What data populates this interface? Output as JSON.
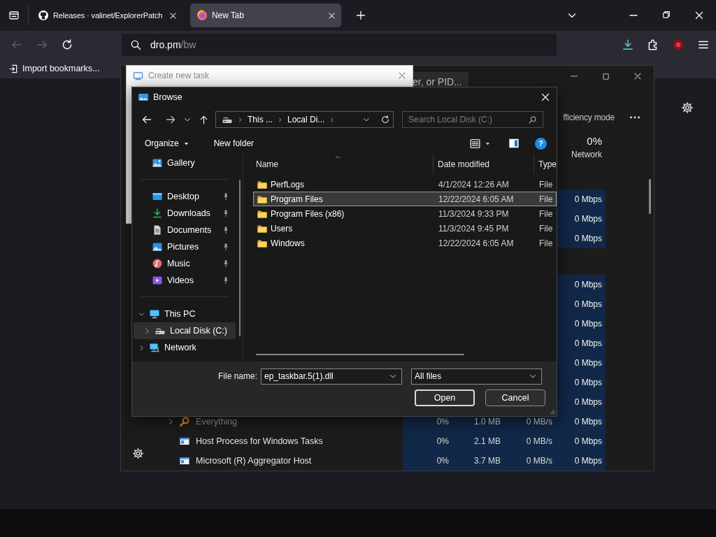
{
  "browser": {
    "tabs": [
      {
        "title": "Releases · valinet/ExplorerPatch",
        "kind": "github",
        "selected": false
      },
      {
        "title": "New Tab",
        "kind": "firefox",
        "selected": true
      }
    ],
    "nav": [
      {
        "kind": "back",
        "disabled": true
      },
      {
        "kind": "forward",
        "disabled": true
      },
      {
        "kind": "reload",
        "disabled": false
      }
    ],
    "address": {
      "host": "dro.pm",
      "path": "/bw"
    },
    "bookmarks": [
      {
        "label": "Import bookmarks..."
      }
    ]
  },
  "task_manager": {
    "search_placeholder": "er, or PID...",
    "toolbar_label": "fficiency mode",
    "network_header": {
      "value": "0%",
      "label": "Network"
    },
    "rows": [
      {
        "kind": "process",
        "network": "0 Mbps"
      },
      {
        "kind": "process",
        "network": "0 Mbps"
      },
      {
        "kind": "process",
        "network": "0 Mbps"
      },
      {
        "kind": "group"
      },
      {
        "kind": "process",
        "network": "0 Mbps"
      },
      {
        "kind": "process",
        "network": "0 Mbps"
      },
      {
        "kind": "process",
        "network": "0 Mbps"
      },
      {
        "kind": "process",
        "network": "0 Mbps"
      },
      {
        "kind": "process",
        "network": "0 Mbps"
      },
      {
        "kind": "process",
        "network": "0 Mbps"
      },
      {
        "kind": "process",
        "network": "0 Mbps"
      },
      {
        "kind": "search_app",
        "name": "Everything",
        "expandable": true,
        "dimmed": true,
        "cpu": "0%",
        "memory": "1.0 MB",
        "disk": "0 MB/s",
        "network": "0 Mbps"
      },
      {
        "kind": "window_app",
        "name": "Host Process for Windows Tasks",
        "expandable": false,
        "dimmed": false,
        "cpu": "0%",
        "memory": "2.1 MB",
        "disk": "0 MB/s",
        "network": "0 Mbps"
      },
      {
        "kind": "window_app",
        "name": "Microsoft (R) Aggregator Host",
        "expandable": false,
        "dimmed": false,
        "cpu": "0%",
        "memory": "3.7 MB",
        "disk": "0 MB/s",
        "network": "0 Mbps"
      }
    ]
  },
  "create_task": {
    "title": "Create new task"
  },
  "browse": {
    "title": "Browse",
    "breadcrumb": [
      "This ...",
      "Local Di..."
    ],
    "search_placeholder": "Search Local Disk (C:)",
    "commands": [
      {
        "label": "Organize",
        "menu": true
      },
      {
        "label": "New folder",
        "menu": false
      }
    ],
    "help_label": "?",
    "sidebar": {
      "groups": [
        [
          {
            "label": "Gallery",
            "kind": "gallery",
            "pinned": false,
            "selected": false
          }
        ],
        [
          {
            "label": "Desktop",
            "kind": "desktop",
            "pinned": true,
            "selected": false
          },
          {
            "label": "Downloads",
            "kind": "downloads",
            "pinned": true,
            "selected": false
          },
          {
            "label": "Documents",
            "kind": "documents",
            "pinned": true,
            "selected": false
          },
          {
            "label": "Pictures",
            "kind": "pictures",
            "pinned": true,
            "selected": false
          },
          {
            "label": "Music",
            "kind": "music",
            "pinned": true,
            "selected": false
          },
          {
            "label": "Videos",
            "kind": "videos",
            "pinned": true,
            "selected": false
          }
        ]
      ],
      "tree": [
        {
          "label": "This PC",
          "kind": "pc",
          "expanded": true,
          "selected": false,
          "children": [
            {
              "label": "Local Disk (C:)",
              "kind": "drive",
              "expanded": false,
              "selected": true
            }
          ]
        },
        {
          "label": "Network",
          "kind": "network",
          "expanded": false,
          "selected": false
        }
      ]
    },
    "columns": [
      {
        "label": "Name",
        "sorted": true
      },
      {
        "label": "Date modified",
        "sorted": false
      },
      {
        "label": "Type",
        "sorted": false
      }
    ],
    "files": [
      {
        "name": "PerfLogs",
        "date": "4/1/2024 12:26 AM",
        "type": "File",
        "selected": false
      },
      {
        "name": "Program Files",
        "date": "12/22/2024 6:05 AM",
        "type": "File",
        "selected": true
      },
      {
        "name": "Program Files (x86)",
        "date": "11/3/2024 9:33 PM",
        "type": "File",
        "selected": false
      },
      {
        "name": "Users",
        "date": "11/3/2024 9:45 PM",
        "type": "File",
        "selected": false
      },
      {
        "name": "Windows",
        "date": "12/22/2024 6:05 AM",
        "type": "File",
        "selected": false
      }
    ],
    "file_name_label": "File name:",
    "file_name": "ep_taskbar.5(1).dll",
    "filter": "All files",
    "buttons": [
      {
        "label": "Open",
        "default": true
      },
      {
        "label": "Cancel",
        "default": false
      }
    ]
  }
}
